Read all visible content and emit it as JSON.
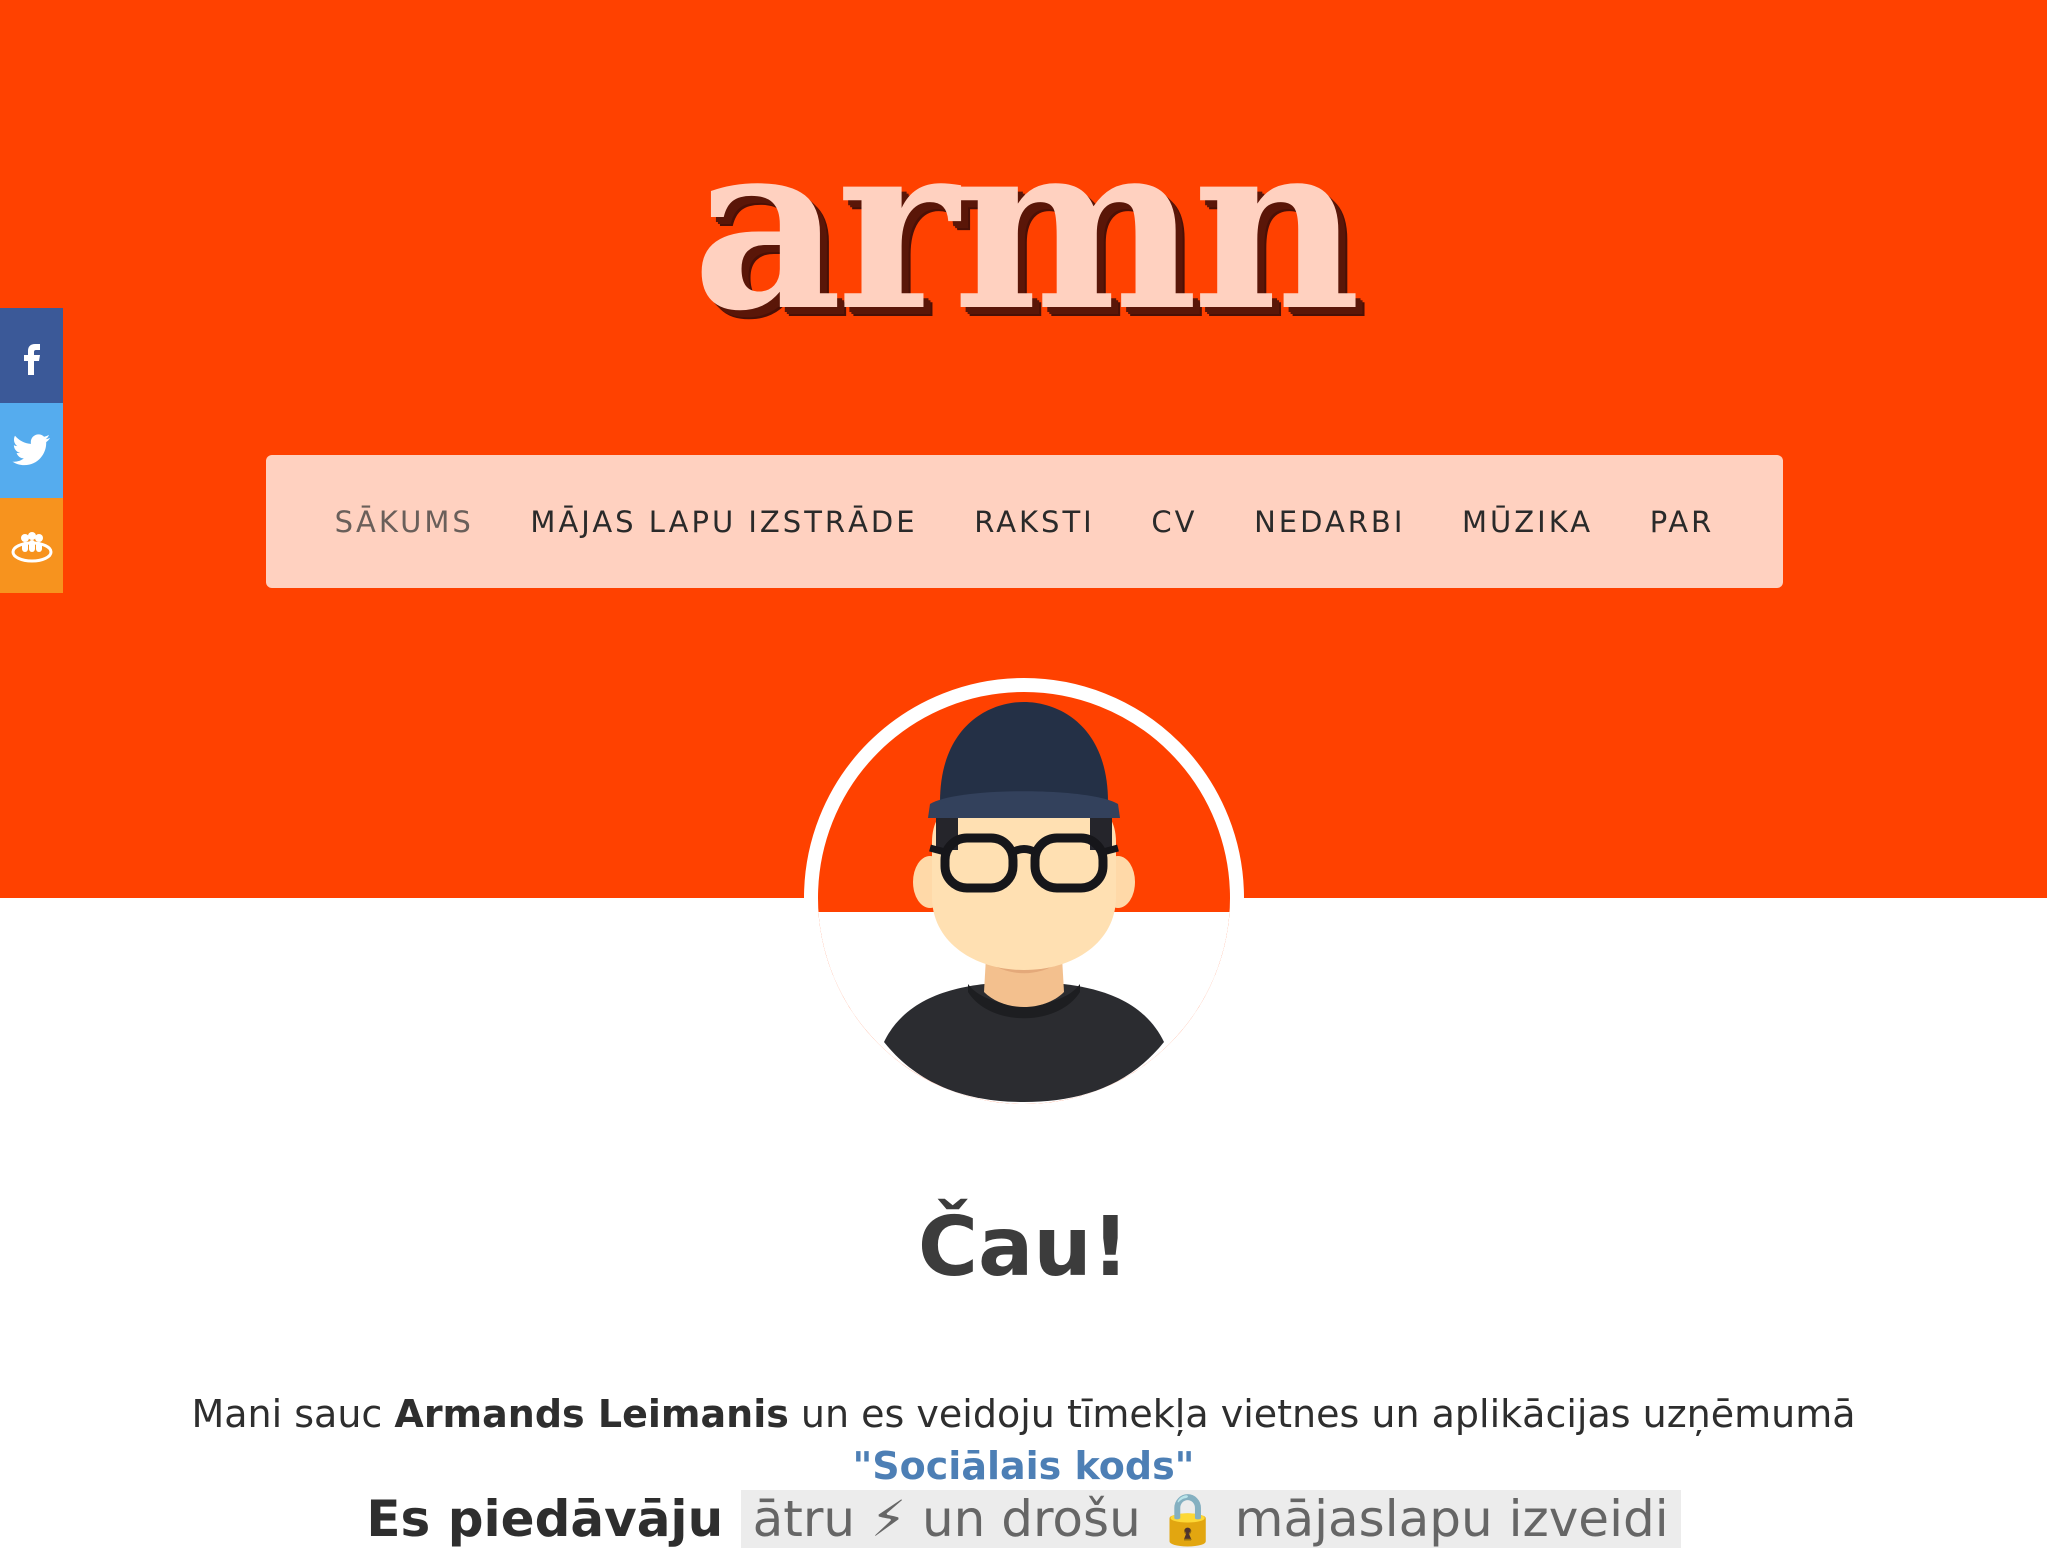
{
  "site": {
    "logo": "armn"
  },
  "nav": {
    "items": [
      {
        "label": "SĀKUMS"
      },
      {
        "label": "MĀJAS LAPU IZSTRĀDE"
      },
      {
        "label": "RAKSTI"
      },
      {
        "label": "CV"
      },
      {
        "label": "NEDARBI"
      },
      {
        "label": "MŪZIKA"
      },
      {
        "label": "PAR"
      }
    ]
  },
  "social": {
    "icons": [
      "facebook-icon",
      "twitter-icon",
      "draugiem-icon"
    ],
    "colors": {
      "facebook": "#3b5998",
      "twitter": "#55acee",
      "draugiem": "#f7931e"
    }
  },
  "main": {
    "greeting": "Čau!",
    "intro": {
      "before": "Mani sauc ",
      "name": "Armands Leimanis",
      "middle": " un es veidoju tīmekļa vietnes un aplikācijas uzņēmumā ",
      "company_link": "\"Sociālais kods\""
    },
    "offer": {
      "before": "Es piedāvāju ",
      "highlight": "ātru ⚡ un drošu 🔒 mājaslapu izveidi"
    }
  },
  "colors": {
    "header": "#ff4100",
    "logo": "#ffd1c0",
    "nav_bg": "#ffd1c0",
    "link": "#4d7fb5"
  }
}
